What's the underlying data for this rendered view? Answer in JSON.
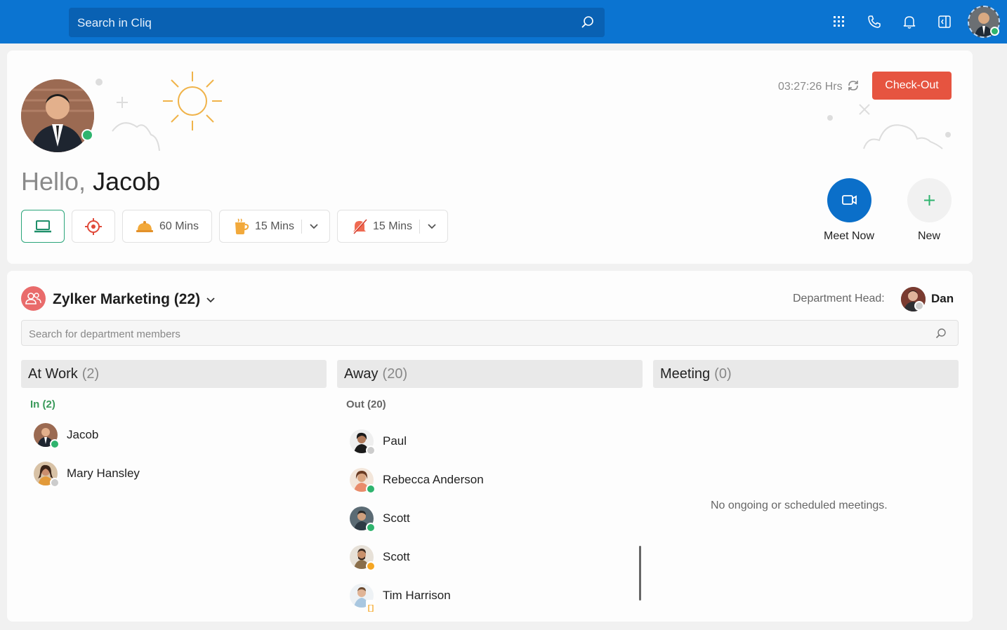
{
  "topbar": {
    "search_placeholder": "Search in Cliq",
    "icons": [
      "apps-grid-icon",
      "phone-icon",
      "bell-icon",
      "panel-icon",
      "profile-avatar"
    ]
  },
  "hero": {
    "greeting": "Hello,",
    "name": "Jacob",
    "timer": "03:27:26 Hrs",
    "checkout_label": "Check-Out",
    "pills": [
      {
        "icon": "laptop-icon",
        "label": ""
      },
      {
        "icon": "target-icon",
        "label": ""
      },
      {
        "icon": "food-cloche-icon",
        "label": "60 Mins"
      },
      {
        "icon": "coffee-cup-icon",
        "label": "15 Mins"
      },
      {
        "icon": "bell-off-icon",
        "label": "15 Mins"
      }
    ],
    "meet_now_label": "Meet Now",
    "new_label": "New"
  },
  "department": {
    "title": "Zylker Marketing (22)",
    "head_label": "Department Head:",
    "head_name": "Dan",
    "search_placeholder": "Search for department members",
    "columns": [
      {
        "title": "At Work",
        "count": "(2)",
        "sub": "In (2)",
        "sub_color": "#3a9a5a"
      },
      {
        "title": "Away",
        "count": "(20)",
        "sub": "Out (20)",
        "sub_color": "#666666"
      },
      {
        "title": "Meeting",
        "count": "(0)",
        "empty_message": "No ongoing or scheduled meetings."
      }
    ],
    "at_work_members": [
      "Jacob",
      "Mary  Hansley"
    ],
    "away_members": [
      "Paul",
      "Rebecca Anderson",
      "Scott",
      "Scott",
      "Tim Harrison"
    ]
  },
  "colors": {
    "brand_blue": "#0b74d1",
    "checkout_red": "#e65440",
    "online_green": "#2fb46e",
    "away_orange": "#f5a623",
    "offline_grey": "#cccccc"
  }
}
